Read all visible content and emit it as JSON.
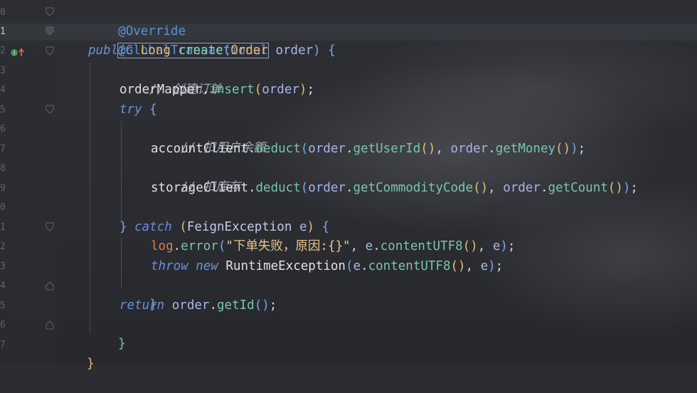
{
  "editor": {
    "line_numbers": [
      "0",
      "1",
      "2",
      "3",
      "4",
      "5",
      "6",
      "7",
      "8",
      "9",
      "0",
      "1",
      "2",
      "3",
      "4",
      "5",
      "6",
      "7"
    ],
    "active_line_index": 1,
    "lines": {
      "l0": {
        "annotation": "@Override"
      },
      "l1": {
        "annotation": "@GlobalTransactional"
      },
      "l2": {
        "kw": "public",
        "type": "Long",
        "fn": "create",
        "p_open": "(",
        "ptype": "Order",
        "pname": "order",
        "p_close": ")",
        "brace": "{"
      },
      "l3": {
        "comment": "// 创建订单"
      },
      "l4": {
        "obj": "orderMapper",
        "dot": ".",
        "method": "insert",
        "po": "(",
        "arg": "order",
        "pc": ")",
        "semi": ";"
      },
      "l5": {
        "kw": "try",
        "brace": "{"
      },
      "l6": {
        "comment": "// 扣用户余额"
      },
      "l7": {
        "obj": "accountClient",
        "method": "deduct",
        "a1": "order",
        "m1": "getUserId",
        "a2": "order",
        "m2": "getMoney"
      },
      "l8": {
        "comment": "// 扣库存"
      },
      "l9": {
        "obj": "storageClient",
        "method": "deduct",
        "a1": "order",
        "m1": "getCommodityCode",
        "a2": "order",
        "m2": "getCount"
      },
      "l11": {
        "close": "}",
        "kw": "catch",
        "po": "(",
        "type": "FeignException",
        "var": "e",
        "pc": ")",
        "brace": "{"
      },
      "l12": {
        "obj": "log",
        "method": "error",
        "str": "\"下单失败，原因:{}\"",
        "var": "e",
        "m": "contentUTF8",
        "var2": "e"
      },
      "l13": {
        "kw": "throw",
        "kw2": "new",
        "type": "RuntimeException",
        "var": "e",
        "m": "contentUTF8",
        "var2": "e"
      },
      "l14": {
        "close": "}"
      },
      "l15": {
        "kw": "return",
        "var": "order",
        "m": "getId"
      },
      "l16": {
        "close": "}"
      },
      "l17": {
        "close": "}"
      }
    }
  },
  "colors": {
    "background": "#2b2d33",
    "annotation": "#5f8fd6",
    "keyword": "#6a8fd8",
    "type": "#e8b66b",
    "method": "#77c7a8",
    "comment": "#9aa0aa",
    "string": "#e7c78a"
  },
  "gutter_icon": "implementation-marker-icon"
}
